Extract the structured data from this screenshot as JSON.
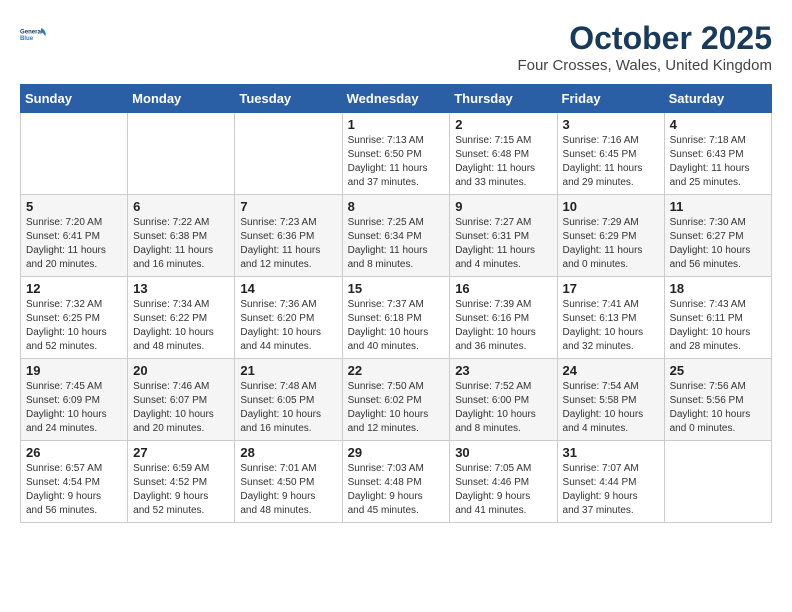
{
  "header": {
    "logo_line1": "General",
    "logo_line2": "Blue",
    "month": "October 2025",
    "location": "Four Crosses, Wales, United Kingdom"
  },
  "weekdays": [
    "Sunday",
    "Monday",
    "Tuesday",
    "Wednesday",
    "Thursday",
    "Friday",
    "Saturday"
  ],
  "weeks": [
    [
      {
        "day": "",
        "info": ""
      },
      {
        "day": "",
        "info": ""
      },
      {
        "day": "",
        "info": ""
      },
      {
        "day": "1",
        "info": "Sunrise: 7:13 AM\nSunset: 6:50 PM\nDaylight: 11 hours\nand 37 minutes."
      },
      {
        "day": "2",
        "info": "Sunrise: 7:15 AM\nSunset: 6:48 PM\nDaylight: 11 hours\nand 33 minutes."
      },
      {
        "day": "3",
        "info": "Sunrise: 7:16 AM\nSunset: 6:45 PM\nDaylight: 11 hours\nand 29 minutes."
      },
      {
        "day": "4",
        "info": "Sunrise: 7:18 AM\nSunset: 6:43 PM\nDaylight: 11 hours\nand 25 minutes."
      }
    ],
    [
      {
        "day": "5",
        "info": "Sunrise: 7:20 AM\nSunset: 6:41 PM\nDaylight: 11 hours\nand 20 minutes."
      },
      {
        "day": "6",
        "info": "Sunrise: 7:22 AM\nSunset: 6:38 PM\nDaylight: 11 hours\nand 16 minutes."
      },
      {
        "day": "7",
        "info": "Sunrise: 7:23 AM\nSunset: 6:36 PM\nDaylight: 11 hours\nand 12 minutes."
      },
      {
        "day": "8",
        "info": "Sunrise: 7:25 AM\nSunset: 6:34 PM\nDaylight: 11 hours\nand 8 minutes."
      },
      {
        "day": "9",
        "info": "Sunrise: 7:27 AM\nSunset: 6:31 PM\nDaylight: 11 hours\nand 4 minutes."
      },
      {
        "day": "10",
        "info": "Sunrise: 7:29 AM\nSunset: 6:29 PM\nDaylight: 11 hours\nand 0 minutes."
      },
      {
        "day": "11",
        "info": "Sunrise: 7:30 AM\nSunset: 6:27 PM\nDaylight: 10 hours\nand 56 minutes."
      }
    ],
    [
      {
        "day": "12",
        "info": "Sunrise: 7:32 AM\nSunset: 6:25 PM\nDaylight: 10 hours\nand 52 minutes."
      },
      {
        "day": "13",
        "info": "Sunrise: 7:34 AM\nSunset: 6:22 PM\nDaylight: 10 hours\nand 48 minutes."
      },
      {
        "day": "14",
        "info": "Sunrise: 7:36 AM\nSunset: 6:20 PM\nDaylight: 10 hours\nand 44 minutes."
      },
      {
        "day": "15",
        "info": "Sunrise: 7:37 AM\nSunset: 6:18 PM\nDaylight: 10 hours\nand 40 minutes."
      },
      {
        "day": "16",
        "info": "Sunrise: 7:39 AM\nSunset: 6:16 PM\nDaylight: 10 hours\nand 36 minutes."
      },
      {
        "day": "17",
        "info": "Sunrise: 7:41 AM\nSunset: 6:13 PM\nDaylight: 10 hours\nand 32 minutes."
      },
      {
        "day": "18",
        "info": "Sunrise: 7:43 AM\nSunset: 6:11 PM\nDaylight: 10 hours\nand 28 minutes."
      }
    ],
    [
      {
        "day": "19",
        "info": "Sunrise: 7:45 AM\nSunset: 6:09 PM\nDaylight: 10 hours\nand 24 minutes."
      },
      {
        "day": "20",
        "info": "Sunrise: 7:46 AM\nSunset: 6:07 PM\nDaylight: 10 hours\nand 20 minutes."
      },
      {
        "day": "21",
        "info": "Sunrise: 7:48 AM\nSunset: 6:05 PM\nDaylight: 10 hours\nand 16 minutes."
      },
      {
        "day": "22",
        "info": "Sunrise: 7:50 AM\nSunset: 6:02 PM\nDaylight: 10 hours\nand 12 minutes."
      },
      {
        "day": "23",
        "info": "Sunrise: 7:52 AM\nSunset: 6:00 PM\nDaylight: 10 hours\nand 8 minutes."
      },
      {
        "day": "24",
        "info": "Sunrise: 7:54 AM\nSunset: 5:58 PM\nDaylight: 10 hours\nand 4 minutes."
      },
      {
        "day": "25",
        "info": "Sunrise: 7:56 AM\nSunset: 5:56 PM\nDaylight: 10 hours\nand 0 minutes."
      }
    ],
    [
      {
        "day": "26",
        "info": "Sunrise: 6:57 AM\nSunset: 4:54 PM\nDaylight: 9 hours\nand 56 minutes."
      },
      {
        "day": "27",
        "info": "Sunrise: 6:59 AM\nSunset: 4:52 PM\nDaylight: 9 hours\nand 52 minutes."
      },
      {
        "day": "28",
        "info": "Sunrise: 7:01 AM\nSunset: 4:50 PM\nDaylight: 9 hours\nand 48 minutes."
      },
      {
        "day": "29",
        "info": "Sunrise: 7:03 AM\nSunset: 4:48 PM\nDaylight: 9 hours\nand 45 minutes."
      },
      {
        "day": "30",
        "info": "Sunrise: 7:05 AM\nSunset: 4:46 PM\nDaylight: 9 hours\nand 41 minutes."
      },
      {
        "day": "31",
        "info": "Sunrise: 7:07 AM\nSunset: 4:44 PM\nDaylight: 9 hours\nand 37 minutes."
      },
      {
        "day": "",
        "info": ""
      }
    ]
  ]
}
